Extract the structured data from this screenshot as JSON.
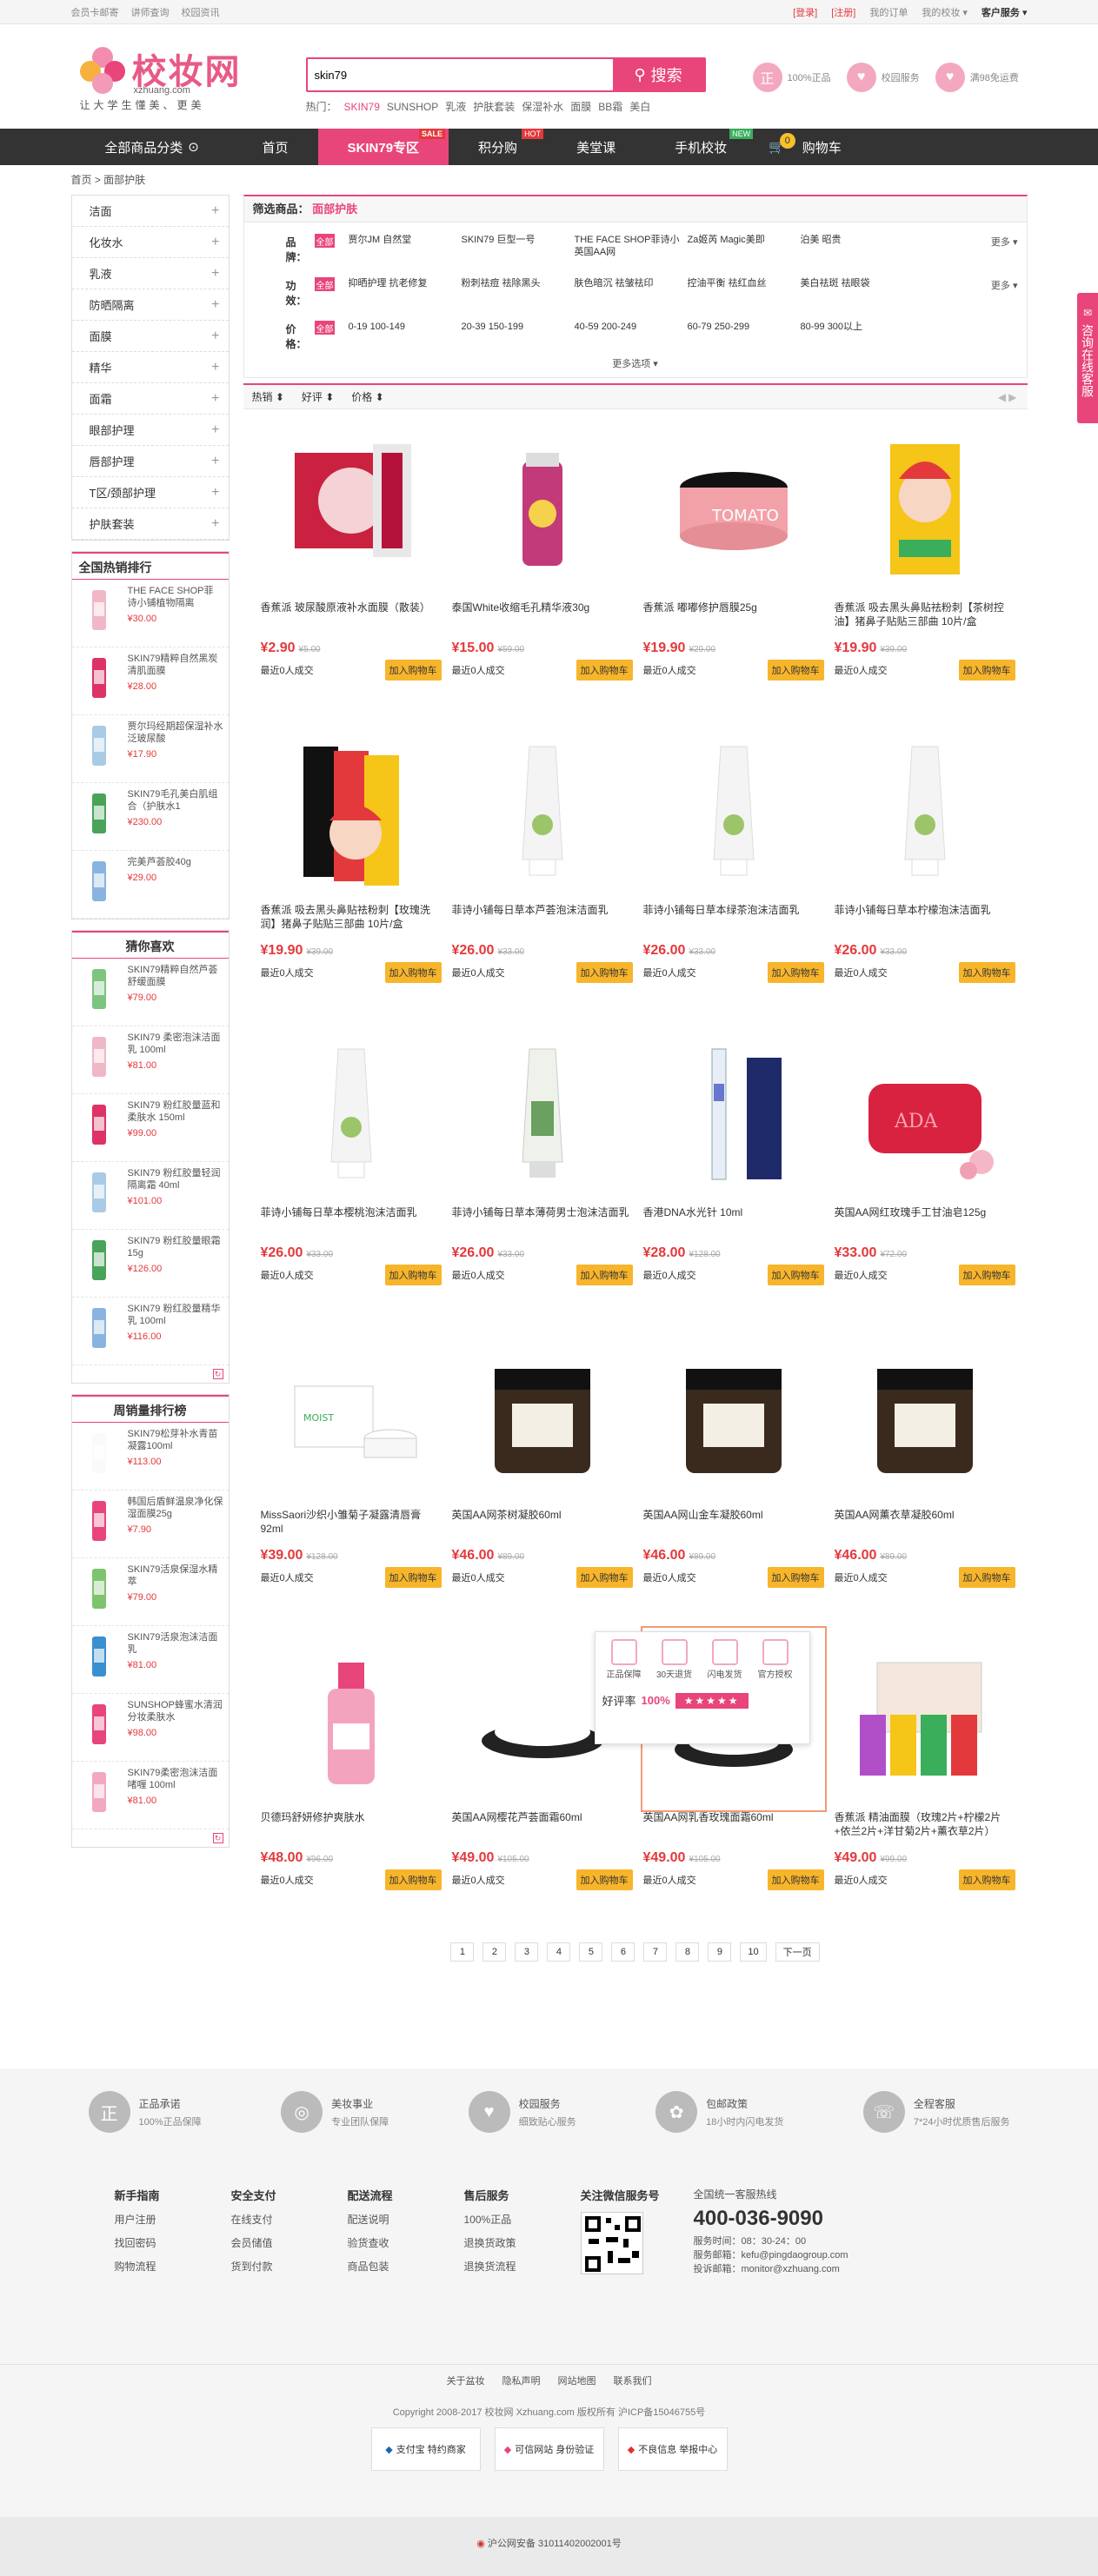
{
  "topbar": {
    "left": [
      "会员卡邮寄",
      "讲师查询",
      "校园资讯"
    ],
    "right": [
      "[登录]",
      "[注册]",
      "我的订单",
      "我的校妆 ▾",
      "客户服务 ▾"
    ]
  },
  "logo": {
    "name": "校妆网",
    "domain": "xzhuang.com",
    "slogan": "让大学生懂美、更美"
  },
  "search": {
    "value": "skin79",
    "button": "搜索"
  },
  "hotwords": [
    "热门：",
    "SKIN79",
    "SUNSHOP",
    "乳液",
    "护肤套装",
    "保湿补水",
    "面膜",
    "BB霜",
    "美白"
  ],
  "promises": [
    {
      "icon": "正",
      "label": "100%正品"
    },
    {
      "icon": "♥",
      "label": "校园服务"
    },
    {
      "icon": "♥",
      "label": "满98免运费"
    }
  ],
  "nav": {
    "all": "全部商品分类",
    "items": [
      {
        "label": "首页",
        "tag": ""
      },
      {
        "label": "SKIN79专区",
        "tag": "SALE"
      },
      {
        "label": "积分购",
        "tag": "HOT"
      },
      {
        "label": "美堂课",
        "tag": ""
      },
      {
        "label": "手机校妆",
        "tag": "NEW"
      }
    ],
    "cart": "购物车",
    "cart_count": "0"
  },
  "breadcrumb": "首页  >  面部护肤",
  "categories": [
    "洁面",
    "化妆水",
    "乳液",
    "防晒隔离",
    "面膜",
    "精华",
    "面霜",
    "眼部护理",
    "唇部护理",
    "T区/颈部护理",
    "护肤套装"
  ],
  "hot_rank": {
    "title": "全国热销排行",
    "items": [
      {
        "name": "THE FACE SHOP菲诗小铺植物隔离",
        "price": "¥30.00"
      },
      {
        "name": "SKIN79精粹自然黑炭清肌面膜",
        "price": "¥28.00"
      },
      {
        "name": "贾尔玛经期超保湿补水泛玻尿酸",
        "price": "¥17.90"
      },
      {
        "name": "SKIN79毛孔美白肌组合（护肤水1",
        "price": "¥230.00"
      },
      {
        "name": "完美芦荟胶40g",
        "price": "¥29.00"
      }
    ]
  },
  "guess": {
    "title": "猜你喜欢",
    "items": [
      {
        "name": "SKIN79精粹自然芦荟舒缓面膜",
        "price": "¥79.00"
      },
      {
        "name": "SKIN79 柔密泡沫洁面乳 100ml",
        "price": "¥81.00"
      },
      {
        "name": "SKIN79 粉红胶量蓝和柔肤水 150ml",
        "price": "¥99.00"
      },
      {
        "name": "SKIN79 粉红胶量轻润隔离霜 40ml",
        "price": "¥101.00"
      },
      {
        "name": "SKIN79 粉红胶量眼霜 15g",
        "price": "¥126.00"
      },
      {
        "name": "SKIN79 粉红胶量精华乳 100ml",
        "price": "¥116.00"
      }
    ]
  },
  "weekly": {
    "title": "周销量排行榜",
    "items": [
      {
        "name": "SKIN79松芽补水青苗凝露100ml",
        "price": "¥113.00"
      },
      {
        "name": "韩国后盾鲜温泉净化保湿面膜25g",
        "price": "¥7.90"
      },
      {
        "name": "SKIN79活泉保湿水精萃",
        "price": "¥79.00"
      },
      {
        "name": "SKIN79活泉泡沫洁面乳",
        "price": "¥81.00"
      },
      {
        "name": "SUNSHOP蜂蜜水清润分妆柔肤水",
        "price": "¥98.00"
      },
      {
        "name": "SKIN79柔密泡沫洁面啫喱 100ml",
        "price": "¥81.00"
      }
    ]
  },
  "filter": {
    "title": "筛选商品：",
    "current": "面部护肤",
    "all_tag": "全部",
    "more": "更多 ▾",
    "more_options": "更多选项 ▾",
    "rows": [
      {
        "label": "品牌：",
        "options": [
          "贾尔JM 自然堂",
          "SKIN79 巨型一号",
          "THE FACE SHOP菲诗小 英国AA网",
          "Za姬芮 Magic美即",
          "泊美 昭贵",
          ""
        ]
      },
      {
        "label": "功效：",
        "options": [
          "抑晒护理 抗老修复",
          "粉刺祛痘 祛除黑头",
          "肤色暗沉 祛皱祛印",
          "控油平衡 祛红血丝",
          "美白祛斑 祛眼袋",
          ""
        ]
      },
      {
        "label": "价格：",
        "options": [
          "0-19 100-149",
          "20-39 150-199",
          "40-59 200-249",
          "60-79 250-299",
          "80-99 300以上",
          ""
        ]
      }
    ]
  },
  "sort": {
    "items": [
      "热销 ⬍",
      "好评 ⬍",
      "价格 ⬍"
    ],
    "pager": "◀ ▶"
  },
  "product_common": {
    "sales": "最近0人成交",
    "add": "加入购物车"
  },
  "products": [
    {
      "name": "香蕉派 玻尿酸原液补水面膜（散装）",
      "price": "¥2.90",
      "old": "¥5.00",
      "img": "mask"
    },
    {
      "name": "泰国White收缩毛孔精华液30g",
      "price": "¥15.00",
      "old": "¥59.00",
      "img": "bottle"
    },
    {
      "name": "香蕉派 嘟嘟修护唇膜25g",
      "price": "¥19.90",
      "old": "¥29.00",
      "img": "jar"
    },
    {
      "name": "香蕉派 吸去黑头鼻贴祛粉刺【茶树控油】猪鼻子贴贴三部曲 10片/盒",
      "price": "¥19.90",
      "old": "¥39.00",
      "img": "pack"
    },
    {
      "name": "香蕉派 吸去黑头鼻贴祛粉刺【玫瑰洗润】猪鼻子贴贴三部曲 10片/盒",
      "price": "¥19.90",
      "old": "¥39.00",
      "img": "pack2"
    },
    {
      "name": "菲诗小铺每日草本芦荟泡沫洁面乳",
      "price": "¥26.00",
      "old": "¥33.00",
      "img": "tube"
    },
    {
      "name": "菲诗小铺每日草本绿茶泡沫洁面乳",
      "price": "¥26.00",
      "old": "¥33.00",
      "img": "tube"
    },
    {
      "name": "菲诗小铺每日草本柠檬泡沫洁面乳",
      "price": "¥26.00",
      "old": "¥33.00",
      "img": "tube"
    },
    {
      "name": "菲诗小铺每日草本樱桃泡沫洁面乳",
      "price": "¥26.00",
      "old": "¥33.00",
      "img": "tube"
    },
    {
      "name": "菲诗小铺每日草本薄荷男士泡沫洁面乳",
      "price": "¥26.00",
      "old": "¥33.00",
      "img": "tube2"
    },
    {
      "name": "香港DNA水光针 10ml",
      "price": "¥28.00",
      "old": "¥128.00",
      "img": "vial"
    },
    {
      "name": "英国AA网红玫瑰手工甘油皂125g",
      "price": "¥33.00",
      "old": "¥72.00",
      "img": "soap"
    },
    {
      "name": "MissSaori沙织小雏菊子凝露清唇膏92ml",
      "price": "¥39.00",
      "old": "¥128.00",
      "img": "cream"
    },
    {
      "name": "英国AA网茶树凝胶60ml",
      "price": "¥46.00",
      "old": "¥89.00",
      "img": "jar2"
    },
    {
      "name": "英国AA网山金车凝胶60ml",
      "price": "¥46.00",
      "old": "¥89.00",
      "img": "jar2"
    },
    {
      "name": "英国AA网薰衣草凝胶60ml",
      "price": "¥46.00",
      "old": "¥89.00",
      "img": "jar2"
    },
    {
      "name": "贝德玛舒妍修护爽肤水",
      "price": "¥48.00",
      "old": "¥96.00",
      "img": "bottle2"
    },
    {
      "name": "英国AA网樱花芦荟面霜60ml",
      "price": "¥49.00",
      "old": "¥105.00",
      "img": "creamjar"
    },
    {
      "name": "英国AA网乳香玫瑰面霜60ml",
      "price": "¥49.00",
      "old": "¥105.00",
      "img": "creamjar2"
    },
    {
      "name": "香蕉派 精油面膜（玫瑰2片+柠檬2片+依兰2片+洋甘菊2片+薰衣草2片）",
      "price": "¥49.00",
      "old": "¥99.00",
      "img": "box"
    }
  ],
  "popup": {
    "icons": [
      "正品保障",
      "30天退货",
      "闪电发货",
      "官方授权"
    ],
    "rate_label": "好评率",
    "rate": "100%",
    "stars": "★★★★★"
  },
  "pagination": [
    "1",
    "2",
    "3",
    "4",
    "5",
    "6",
    "7",
    "8",
    "9",
    "10",
    "下一页"
  ],
  "services": [
    {
      "icon": "正",
      "t1": "正品承诺",
      "t2": "100%正品保障"
    },
    {
      "icon": "◎",
      "t1": "美妆事业",
      "t2": "专业团队保障"
    },
    {
      "icon": "♥",
      "t1": "校园服务",
      "t2": "细致贴心服务"
    },
    {
      "icon": "✿",
      "t1": "包邮政策",
      "t2": "18小时内闪电发货"
    },
    {
      "icon": "☏",
      "t1": "全程客服",
      "t2": "7*24小时优质售后服务"
    }
  ],
  "footer": {
    "cols": [
      {
        "h": "新手指南",
        "l": [
          "用户注册",
          "找回密码",
          "购物流程"
        ]
      },
      {
        "h": "安全支付",
        "l": [
          "在线支付",
          "会员储值",
          "货到付款"
        ]
      },
      {
        "h": "配送流程",
        "l": [
          "配送说明",
          "验货查收",
          "商品包装"
        ]
      },
      {
        "h": "售后服务",
        "l": [
          "100%正品",
          "退换货政策",
          "退换货流程"
        ]
      }
    ],
    "wechat": "关注微信服务号",
    "hotline_title": "全国统一客服热线",
    "hotline": "400-036-9090",
    "hotline_lines": [
      "服务时间：08：30-24：00",
      "服务邮箱：kefu@pingdaogroup.com",
      "投诉邮箱：monitor@xzhuang.com"
    ],
    "links": [
      "关于盆妆",
      "隐私声明",
      "网站地图",
      "联系我们"
    ],
    "copyright": "Copyright 2008-2017 校妆网 Xzhuang.com 版权所有 沪ICP备15046755号",
    "badges": [
      "支付宝 特约商家",
      "可信网站 身份验证",
      "不良信息 举报中心"
    ],
    "police": "沪公网安备 31011402002001号"
  },
  "float_btn": "咨询在线客服",
  "colors": {
    "brand": "#e8457a",
    "price": "#e4393c",
    "add_btn": "#f7b52c",
    "nav": "#333333"
  }
}
